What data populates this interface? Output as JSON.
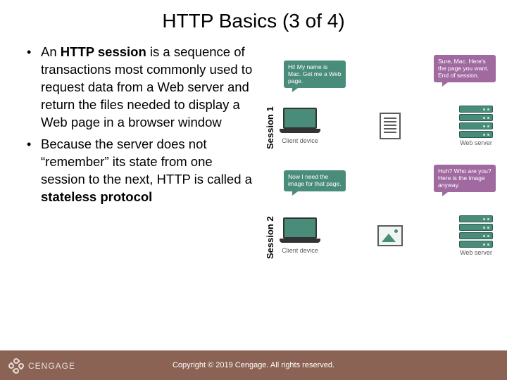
{
  "title": "HTTP Basics (3 of 4)",
  "bullets": [
    {
      "pre": "An ",
      "bold": "HTTP session",
      "post": " is a sequence of transactions most commonly used to request data from a Web server and return the files needed to display a Web page in a browser window"
    },
    {
      "pre": "Because the server does not “remember” its state from one session to the next, HTTP is called a ",
      "bold": "stateless protocol",
      "post": ""
    }
  ],
  "diagram": {
    "sessions": [
      {
        "label": "Session 1",
        "client_bubble": "Hi! My name is Mac. Get me a Web page.",
        "server_bubble": "Sure, Mac. Here's the page you want. End of session.",
        "client_caption": "Client device",
        "server_caption": "Web server",
        "mid_icon": "doc"
      },
      {
        "label": "Session 2",
        "client_bubble": "Now I need the image for that page.",
        "server_bubble": "Huh? Who are you? Here is the image anyway.",
        "client_caption": "Client device",
        "server_caption": "Web server",
        "mid_icon": "pic"
      }
    ]
  },
  "footer": {
    "copyright": "Copyright © 2019 Cengage. All rights reserved.",
    "brand": "CENGAGE"
  }
}
